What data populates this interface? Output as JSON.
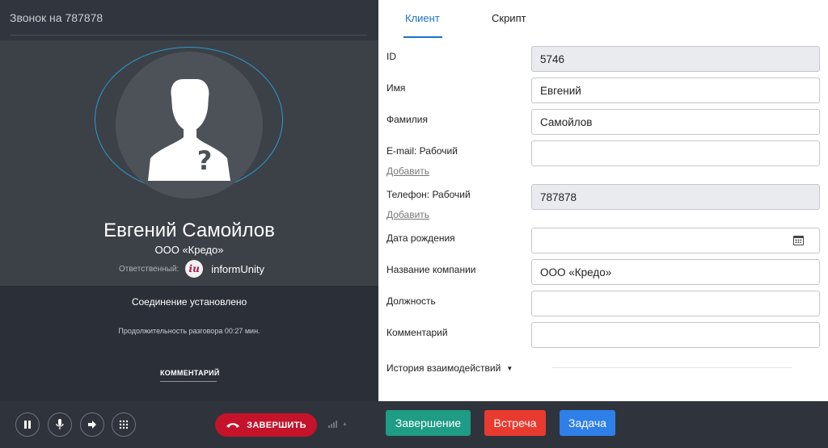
{
  "call": {
    "title": "Звонок на 787878",
    "contact_name": "Евгений Самойлов",
    "company": "ООО «Кредо»",
    "responsible_label": "Ответственный:",
    "responsible_logo": "iu",
    "responsible_name": "informUnity",
    "status": "Соединение установлено",
    "duration": "Продолжительность разговора 00:27 мин.",
    "comment_link": "КОММЕНТАРИЙ",
    "end_call_label": "ЗАВЕРШИТЬ"
  },
  "tabs": {
    "client": "Клиент",
    "script": "Скрипт"
  },
  "form": {
    "id_label": "ID",
    "id_value": "5746",
    "first_name_label": "Имя",
    "first_name_value": "Евгений",
    "last_name_label": "Фамилия",
    "last_name_value": "Самойлов",
    "email_label": "E-mail: Рабочий",
    "email_value": "",
    "email_add": "Добавить",
    "phone_label": "Телефон: Рабочий",
    "phone_value": "787878",
    "phone_add": "Добавить",
    "birthdate_label": "Дата рождения",
    "birthdate_value": "",
    "company_label": "Название компании",
    "company_value": "ООО «Кредо»",
    "position_label": "Должность",
    "position_value": "",
    "comment_label": "Комментарий",
    "comment_value": "",
    "history_label": "История взаимодействий"
  },
  "footer": {
    "finish": "Завершение",
    "meeting": "Встреча",
    "task": "Задача"
  },
  "colors": {
    "accent": "#1a73c8",
    "end_call": "#c4132a",
    "finish": "#1e9c85",
    "meeting": "#e83a2e",
    "task": "#2e7fe8",
    "panel_dark": "#2b3038"
  },
  "icons": {
    "pause": "pause-icon",
    "mic": "microphone-icon",
    "transfer": "transfer-arrow-icon",
    "keypad": "keypad-icon",
    "hangup": "phone-hangup-icon",
    "signal": "signal-icon",
    "calendar": "calendar-icon"
  }
}
